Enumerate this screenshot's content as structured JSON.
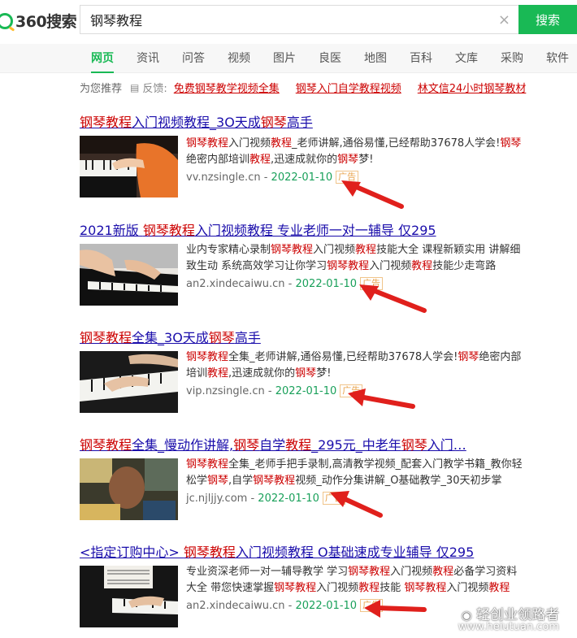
{
  "logo": {
    "text": "360搜索"
  },
  "search": {
    "query": "钢琴教程",
    "button_label": "搜索",
    "clear_glyph": "×"
  },
  "tabs": [
    "网页",
    "资讯",
    "问答",
    "视频",
    "图片",
    "良医",
    "地图",
    "百科",
    "文库",
    "采购",
    "软件"
  ],
  "recommend": {
    "label": "为您推荐",
    "feedback_label": "反馈:",
    "links": [
      "免费钢琴教学视频全集",
      "钢琴入门自学教程视频",
      "林文信24小时钢琴教材"
    ]
  },
  "ad_badge": "广告",
  "results": [
    {
      "title": [
        [
          "钢琴教程",
          1
        ],
        [
          "入门视频教程_3O天成",
          0
        ],
        [
          "钢琴",
          1
        ],
        [
          "高手",
          0
        ]
      ],
      "desc": [
        [
          "钢琴教程",
          1
        ],
        [
          "入门视频",
          0
        ],
        [
          "教程",
          1
        ],
        [
          "_老师讲解,通俗易懂,已经帮助37678人学会!",
          0
        ],
        [
          "钢琴",
          1
        ],
        [
          "绝密内部培训",
          0
        ],
        [
          "教程",
          1
        ],
        [
          ",迅速成就你的",
          0
        ],
        [
          "钢琴",
          1
        ],
        [
          "梦!",
          0
        ]
      ],
      "url": "vv.nzsingle.cn",
      "date": "2022-01-10"
    },
    {
      "title": [
        [
          "2021新版 ",
          0
        ],
        [
          "钢琴教程",
          1
        ],
        [
          "入门视频教程",
          0
        ],
        [
          " 专业老师一对一辅导 仅295",
          0
        ]
      ],
      "desc": [
        [
          "业内专家精心录制",
          0
        ],
        [
          "钢琴教程",
          1
        ],
        [
          "入门视频",
          0
        ],
        [
          "教程",
          1
        ],
        [
          "技能大全 课程新颖实用 讲解细致生动 系统高效学习让你学习",
          0
        ],
        [
          "钢琴教程",
          1
        ],
        [
          "入门视频",
          0
        ],
        [
          "教程",
          1
        ],
        [
          "技能少走弯路",
          0
        ]
      ],
      "url": "an2.xindecaiwu.cn",
      "date": "2022-01-10"
    },
    {
      "title": [
        [
          "钢琴教程",
          1
        ],
        [
          "全集_3O天成",
          0
        ],
        [
          "钢琴",
          1
        ],
        [
          "高手",
          0
        ]
      ],
      "desc": [
        [
          "钢琴教程",
          1
        ],
        [
          "全集_老师讲解,通俗易懂,已经帮助37678人学会!",
          0
        ],
        [
          "钢琴",
          1
        ],
        [
          "绝密内部培训",
          0
        ],
        [
          "教程",
          1
        ],
        [
          ",迅速成就你的",
          0
        ],
        [
          "钢琴",
          1
        ],
        [
          "梦!",
          0
        ]
      ],
      "url": "vip.nzsingle.cn",
      "date": "2022-01-10"
    },
    {
      "title": [
        [
          "钢琴教程",
          1
        ],
        [
          "全集_慢动作讲解,",
          0
        ],
        [
          "钢琴",
          1
        ],
        [
          "自学",
          0
        ],
        [
          "教程",
          1
        ],
        [
          "_295元_中老年",
          0
        ],
        [
          "钢琴",
          1
        ],
        [
          "入门…",
          0
        ]
      ],
      "desc": [
        [
          "钢琴教程",
          1
        ],
        [
          "全集_老师手把手录制,高清教学视频_配套入门教学书籍_教你轻松学",
          0
        ],
        [
          "钢琴",
          1
        ],
        [
          ",自学",
          0
        ],
        [
          "钢琴教程",
          1
        ],
        [
          "视频_动作分集讲解_O基础教学_30天初步掌",
          0
        ]
      ],
      "url": "jc.njljjy.com",
      "date": "2022-01-10"
    },
    {
      "title": [
        [
          "<指定订购中心> ",
          0
        ],
        [
          "钢琴教程",
          1
        ],
        [
          "入门视频教程",
          0
        ],
        [
          " O基础速成专业辅导 仅295",
          0
        ]
      ],
      "desc": [
        [
          "专业资深老师一对一辅导教学 学习",
          0
        ],
        [
          "钢琴教程",
          1
        ],
        [
          "入门视频",
          0
        ],
        [
          "教程",
          1
        ],
        [
          "必备学习资料大全 带您快速掌握",
          0
        ],
        [
          "钢琴教程",
          1
        ],
        [
          "入门视频",
          0
        ],
        [
          "教程",
          1
        ],
        [
          "技能 ",
          0
        ],
        [
          "钢琴教程",
          1
        ],
        [
          "入门视频",
          0
        ],
        [
          "教程",
          1
        ]
      ],
      "url": "an2.xindecaiwu.cn",
      "date": "2022-01-10"
    }
  ],
  "watermark": {
    "text": "轻创业领路者",
    "sub": "www.heiutuan.com"
  },
  "colors": {
    "brand_green": "#19b955",
    "highlight_red": "#cc0000",
    "link_blue": "#1a0dab",
    "arrow_red": "#e0201c"
  }
}
